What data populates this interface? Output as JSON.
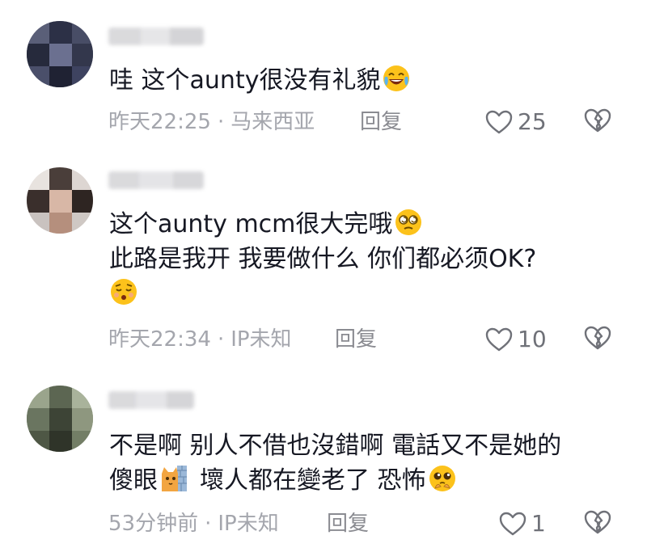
{
  "comments": [
    {
      "text_lines": [
        "哇 这个aunty很没有礼貌"
      ],
      "emoji_names": [
        "laughing-crying-emoji"
      ],
      "time": "昨天22:25",
      "location": "马来西亚",
      "reply_label": "回复",
      "likes": "25"
    },
    {
      "text_lines": [
        "这个aunty mcm很大完哦",
        "此路是我开 我要做什么 你们都必须OK?"
      ],
      "emoji_names": [
        "dizzy-face-emoji",
        "sleepy-face-emoji"
      ],
      "time": "昨天22:34",
      "location": "IP未知",
      "reply_label": "回复",
      "likes": "10"
    },
    {
      "text_lines": [
        "不是啊 别人不借也沒錯啊 電話又不是她的",
        "傻眼",
        "壞人都在變老了 恐怖"
      ],
      "emoji_names": [
        "cat-behind-wall-emoji",
        "pleading-face-emoji"
      ],
      "time": "53分钟前",
      "location": "IP未知",
      "reply_label": "回复",
      "likes": "1"
    }
  ],
  "separator": "·",
  "colors": {
    "text": "#161823",
    "meta": "#a4a6ad",
    "icon": "#6f7178"
  }
}
